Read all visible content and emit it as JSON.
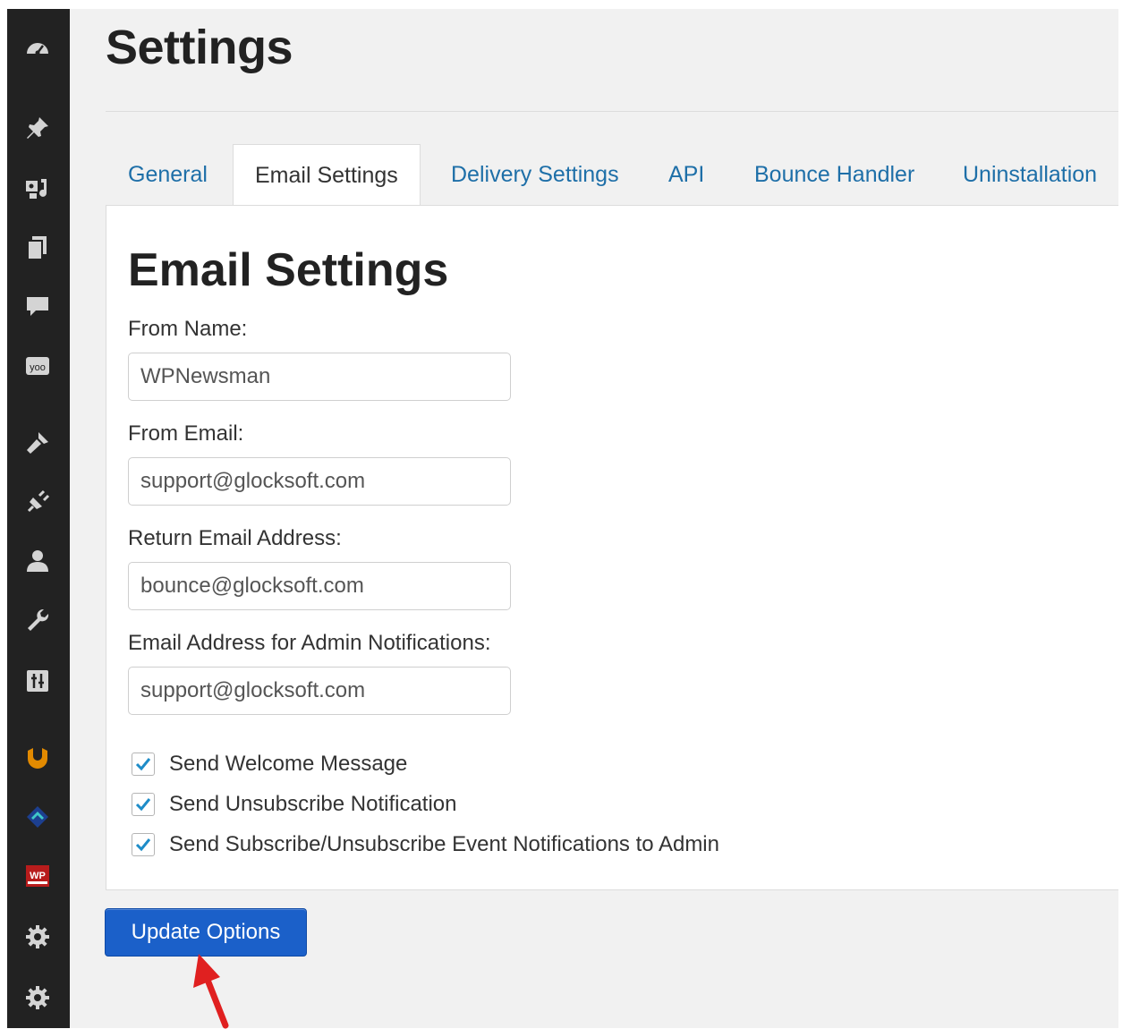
{
  "page": {
    "title": "Settings"
  },
  "sidebar": {
    "items": [
      {
        "icon": "dashboard-icon"
      },
      {
        "icon": "pin-icon"
      },
      {
        "icon": "media-icon"
      },
      {
        "icon": "pages-icon"
      },
      {
        "icon": "comments-icon"
      },
      {
        "icon": "yoo-icon"
      },
      {
        "icon": "appearance-icon"
      },
      {
        "icon": "plugins-icon"
      },
      {
        "icon": "users-icon"
      },
      {
        "icon": "tools-icon"
      },
      {
        "icon": "settings-sliders-icon"
      },
      {
        "icon": "plugin-orange-icon"
      },
      {
        "icon": "plugin-diamond-icon"
      },
      {
        "icon": "plugin-wp-logo-icon"
      },
      {
        "icon": "gear-icon"
      },
      {
        "icon": "gear-icon"
      }
    ]
  },
  "tabs": [
    {
      "label": "General",
      "active": false
    },
    {
      "label": "Email Settings",
      "active": true
    },
    {
      "label": "Delivery Settings",
      "active": false
    },
    {
      "label": "API",
      "active": false
    },
    {
      "label": "Bounce Handler",
      "active": false
    },
    {
      "label": "Uninstallation",
      "active": false
    }
  ],
  "panel": {
    "heading": "Email Settings",
    "fields": [
      {
        "label": "From Name:",
        "value": "WPNewsman"
      },
      {
        "label": "From Email:",
        "value": "support@glocksoft.com"
      },
      {
        "label": "Return Email Address:",
        "value": "bounce@glocksoft.com"
      },
      {
        "label": "Email Address for Admin Notifications:",
        "value": "support@glocksoft.com"
      }
    ],
    "checkboxes": [
      {
        "label": "Send Welcome Message",
        "checked": true
      },
      {
        "label": "Send Unsubscribe Notification",
        "checked": true
      },
      {
        "label": "Send Subscribe/Unsubscribe Event Notifications to Admin",
        "checked": true
      }
    ]
  },
  "actions": {
    "update_label": "Update Options"
  },
  "colors": {
    "link": "#1e6fa8",
    "button": "#1b60c9",
    "checkmark": "#1e8cc8",
    "annotation_arrow": "#e02020",
    "sidebar": "#222222"
  }
}
